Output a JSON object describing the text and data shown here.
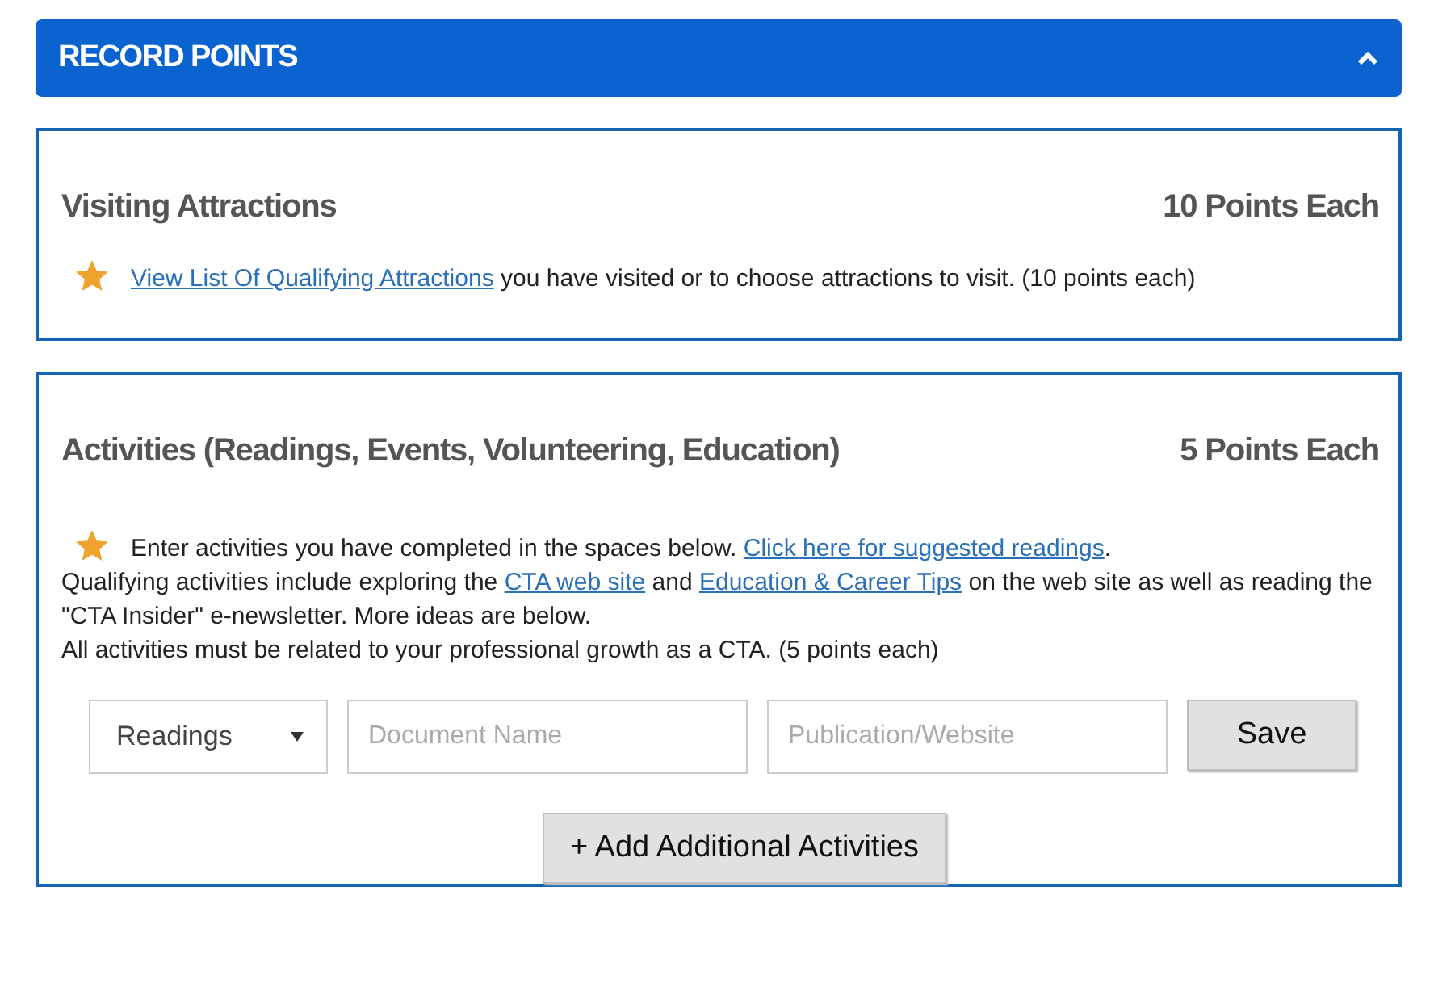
{
  "header": {
    "title": "RECORD POINTS",
    "expanded": true
  },
  "sections": [
    {
      "title": "Visiting Attractions",
      "points": "10 Points Each",
      "paragraphs": [
        [
          {
            "kind": "link",
            "text": "View List Of Qualifying Attractions"
          },
          {
            "kind": "text",
            "text": " you have visited or to choose attractions to visit. (10 points each)"
          }
        ]
      ]
    },
    {
      "title": "Activities (Readings, Events, Volunteering, Education)",
      "points": "5 Points Each",
      "paragraphs": [
        [
          {
            "kind": "text",
            "text": "Enter activities you have completed in the spaces below. "
          },
          {
            "kind": "link",
            "text": "Click here for suggested readings"
          },
          {
            "kind": "text",
            "text": "."
          }
        ],
        [
          {
            "kind": "text",
            "text": "Qualifying activities include exploring the "
          },
          {
            "kind": "link",
            "text": "CTA web site"
          },
          {
            "kind": "text",
            "text": " and "
          },
          {
            "kind": "link",
            "text": "Education & Career Tips"
          },
          {
            "kind": "text",
            "text": " on the web site as well as reading the \"CTA Insider\" e-newsletter. More ideas are below."
          }
        ],
        [
          {
            "kind": "text",
            "text": "All activities must be related to your professional growth as a CTA. (5 points each)"
          }
        ]
      ],
      "form": {
        "type": {
          "value": "Readings"
        },
        "document": {
          "placeholder": "Document Name"
        },
        "publication": {
          "placeholder": "Publication/Website"
        },
        "save": "Save",
        "add": "+ Add Additional Activities"
      }
    }
  ]
}
